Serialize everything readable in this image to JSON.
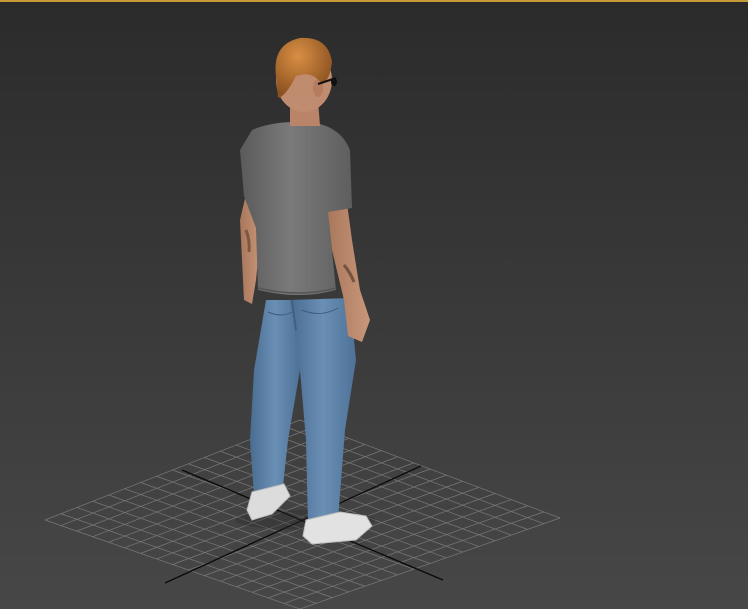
{
  "viewport": {
    "view": "perspective",
    "active_border_color": "#c59a37",
    "background_top": "#2b2b2b",
    "background_bottom": "#474747"
  },
  "scene": {
    "objects": [
      {
        "name": "human-figure",
        "description_icon": "human-model",
        "shirt_color": "#6e6e6e",
        "pants_color": "#5b7fa4",
        "hair_color": "#b5702f",
        "shoe_color": "#d9d9d9"
      },
      {
        "name": "home-grid",
        "grid_color": "#8a8a8a",
        "axis_color": "#0a0a0a"
      }
    ]
  }
}
